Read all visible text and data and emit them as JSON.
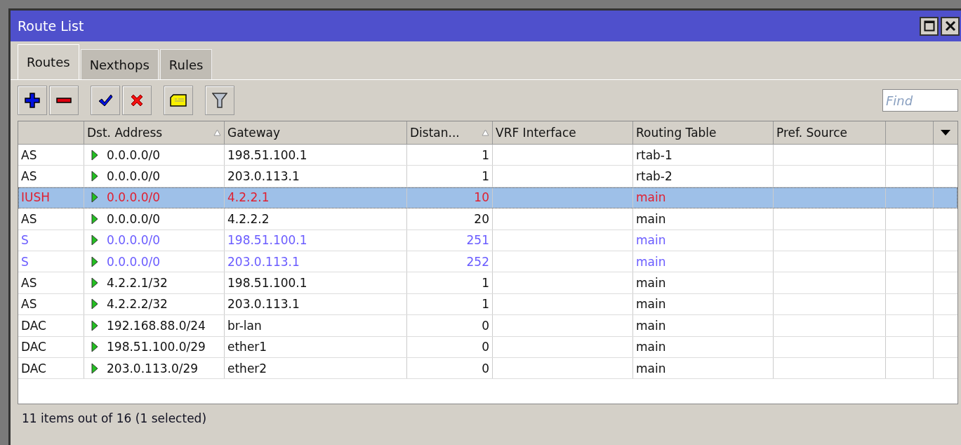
{
  "window": {
    "title": "Route List"
  },
  "tabs": [
    {
      "label": "Routes",
      "selected": true
    },
    {
      "label": "Nexthops",
      "selected": false
    },
    {
      "label": "Rules",
      "selected": false
    }
  ],
  "toolbar": {
    "buttons": [
      {
        "kind": "add"
      },
      {
        "kind": "remove"
      },
      {
        "kind": "enable"
      },
      {
        "kind": "disable"
      },
      {
        "kind": "comment"
      },
      {
        "kind": "filter"
      }
    ],
    "search": {
      "placeholder": "Find"
    }
  },
  "table": {
    "columns": [
      {
        "sorted": false
      },
      {
        "label": "Dst. Address",
        "sorted": true
      },
      {
        "label": "Gateway",
        "sorted": false
      },
      {
        "label": "Distan...",
        "sorted": true
      },
      {
        "label": "VRF Interface",
        "sorted": false
      },
      {
        "label": "Routing Table",
        "sorted": false
      },
      {
        "label": "Pref. Source",
        "sorted": false
      },
      {
        "sorted": false
      }
    ],
    "rows": [
      {
        "flags": "AS",
        "dst": "0.0.0.0/0",
        "gateway": "198.51.100.1",
        "distance": "1",
        "table": "rtab-1",
        "kind": "normal",
        "selected": false
      },
      {
        "flags": "AS",
        "dst": "0.0.0.0/0",
        "gateway": "203.0.113.1",
        "distance": "1",
        "table": "rtab-2",
        "kind": "normal",
        "selected": false
      },
      {
        "flags": "IUSH",
        "dst": "0.0.0.0/0",
        "gateway": "4.2.2.1",
        "distance": "10",
        "table": "main",
        "kind": "invalid",
        "selected": true
      },
      {
        "flags": "AS",
        "dst": "0.0.0.0/0",
        "gateway": "4.2.2.2",
        "distance": "20",
        "table": "main",
        "kind": "normal",
        "selected": false
      },
      {
        "flags": "S",
        "dst": "0.0.0.0/0",
        "gateway": "198.51.100.1",
        "distance": "251",
        "table": "main",
        "kind": "inactive",
        "selected": false
      },
      {
        "flags": "S",
        "dst": "0.0.0.0/0",
        "gateway": "203.0.113.1",
        "distance": "252",
        "table": "main",
        "kind": "inactive",
        "selected": false
      },
      {
        "flags": "AS",
        "dst": "4.2.2.1/32",
        "gateway": "198.51.100.1",
        "distance": "1",
        "table": "main",
        "kind": "normal",
        "selected": false
      },
      {
        "flags": "AS",
        "dst": "4.2.2.2/32",
        "gateway": "203.0.113.1",
        "distance": "1",
        "table": "main",
        "kind": "normal",
        "selected": false
      },
      {
        "flags": "DAC",
        "dst": "192.168.88.0/24",
        "gateway": "br-lan",
        "distance": "0",
        "table": "main",
        "kind": "normal",
        "selected": false
      },
      {
        "flags": "DAC",
        "dst": "198.51.100.0/29",
        "gateway": "ether1",
        "distance": "0",
        "table": "main",
        "kind": "normal",
        "selected": false
      },
      {
        "flags": "DAC",
        "dst": "203.0.113.0/29",
        "gateway": "ether2",
        "distance": "0",
        "table": "main",
        "kind": "normal",
        "selected": false
      }
    ]
  },
  "status_bar": "11 items out of 16 (1 selected)"
}
